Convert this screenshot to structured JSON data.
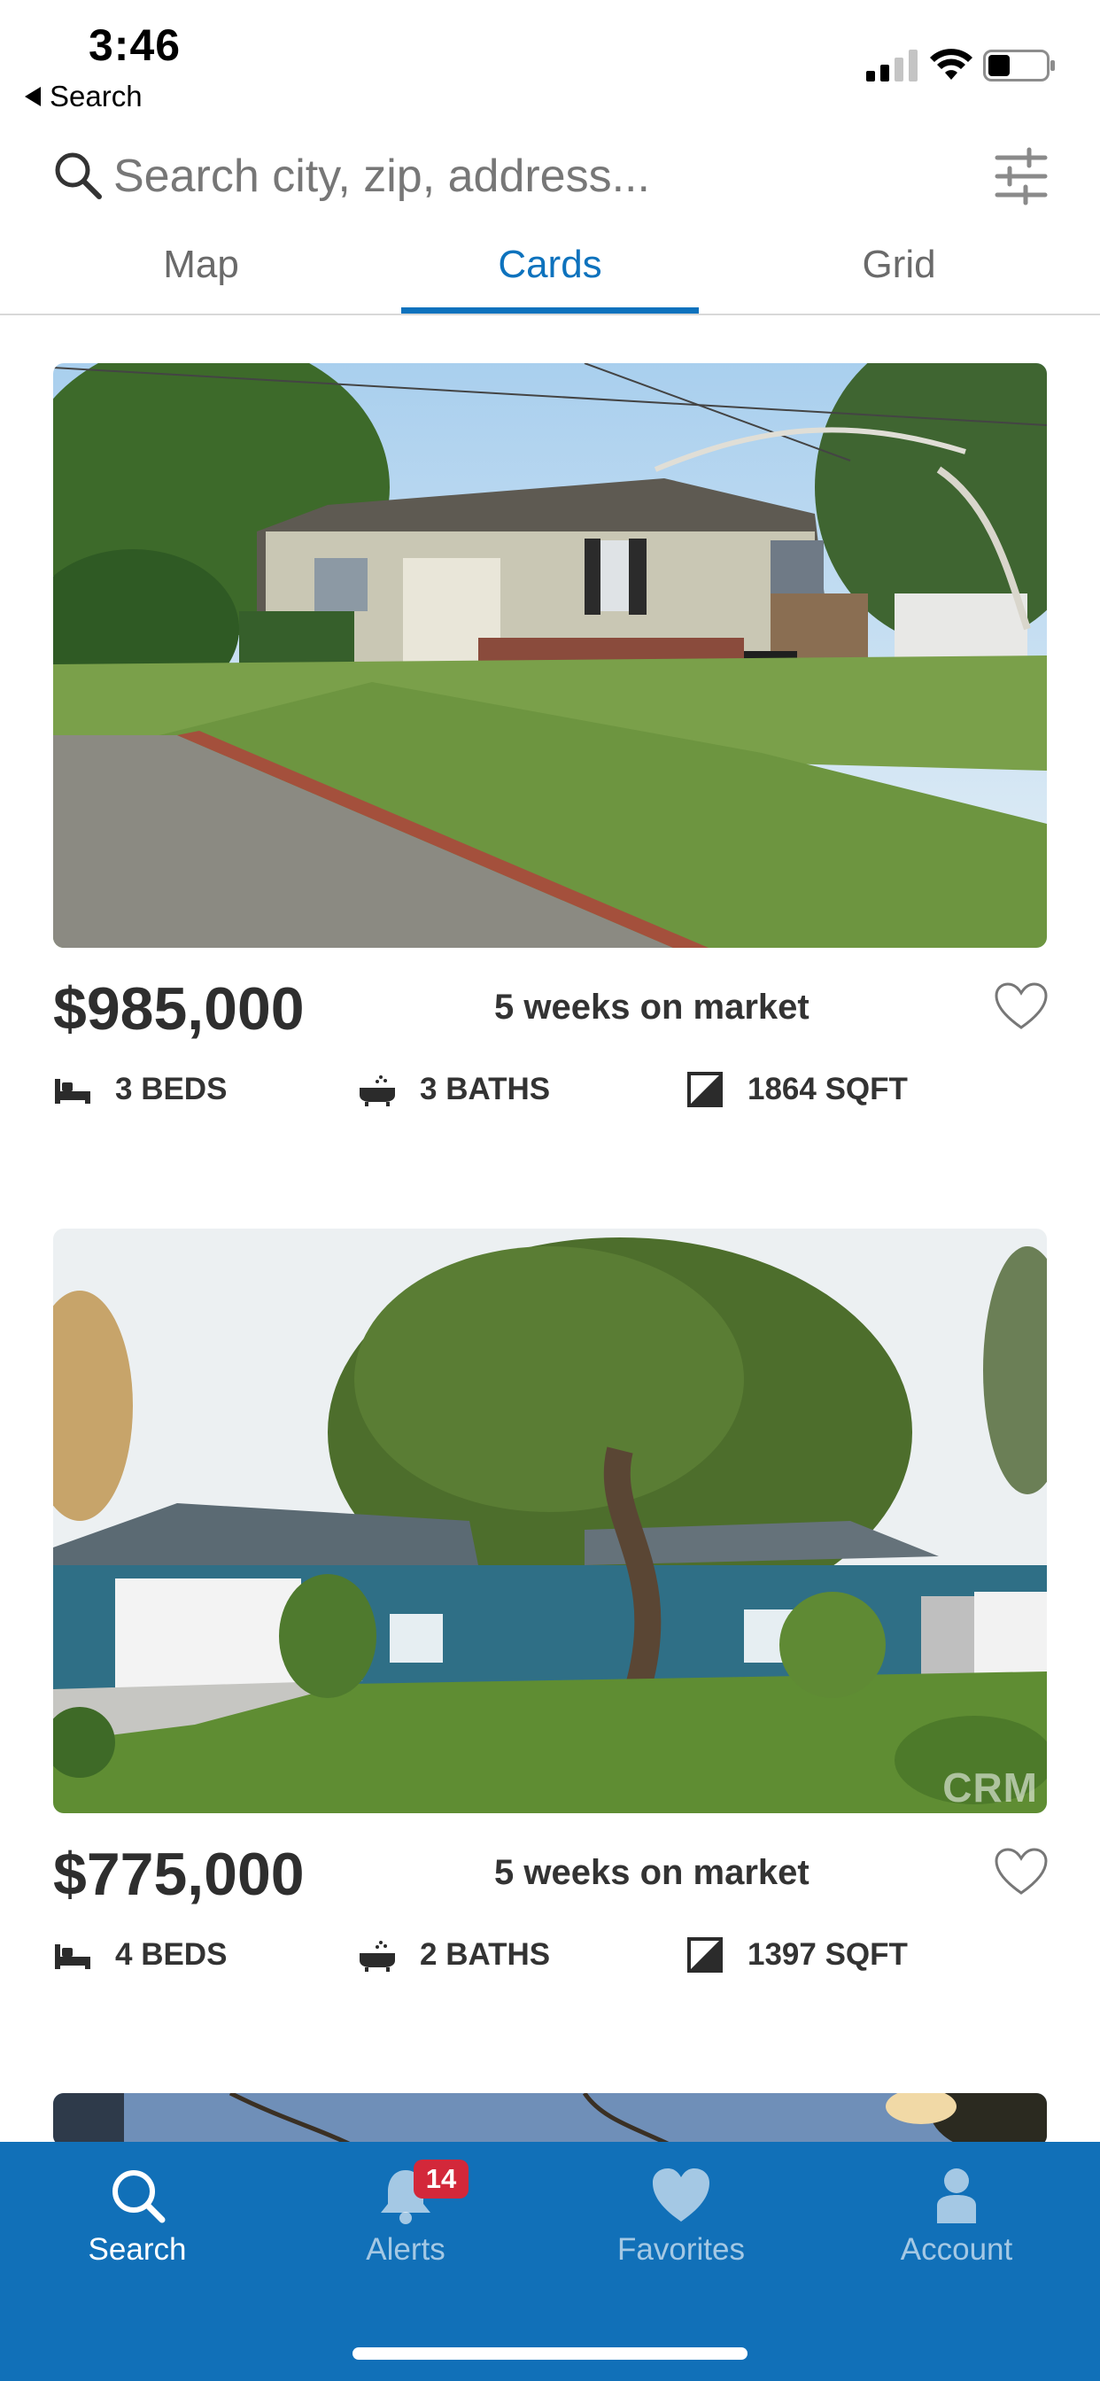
{
  "status_bar": {
    "time": "3:46",
    "back_label": "Search"
  },
  "search": {
    "placeholder": "Search city, zip, address..."
  },
  "tabs": [
    {
      "label": "Map",
      "active": false
    },
    {
      "label": "Cards",
      "active": true
    },
    {
      "label": "Grid",
      "active": false
    }
  ],
  "listings": [
    {
      "price": "$985,000",
      "days_on_market": "5 weeks on market",
      "beds": "3 BEDS",
      "baths": "3 BATHS",
      "sqft": "1864 SQFT",
      "favorited": false
    },
    {
      "price": "$775,000",
      "days_on_market": "5 weeks on market",
      "beds": "4 BEDS",
      "baths": "2 BATHS",
      "sqft": "1397 SQFT",
      "favorited": false,
      "watermark": "CRM"
    }
  ],
  "bottom_nav": {
    "items": [
      {
        "label": "Search",
        "icon": "search-icon",
        "active": true
      },
      {
        "label": "Alerts",
        "icon": "bell-icon",
        "active": false,
        "badge": "14"
      },
      {
        "label": "Favorites",
        "icon": "heart-icon",
        "active": false
      },
      {
        "label": "Account",
        "icon": "person-icon",
        "active": false
      }
    ]
  },
  "colors": {
    "accent": "#0d72bd",
    "nav_background": "#1170b8",
    "badge": "#d3283a"
  }
}
